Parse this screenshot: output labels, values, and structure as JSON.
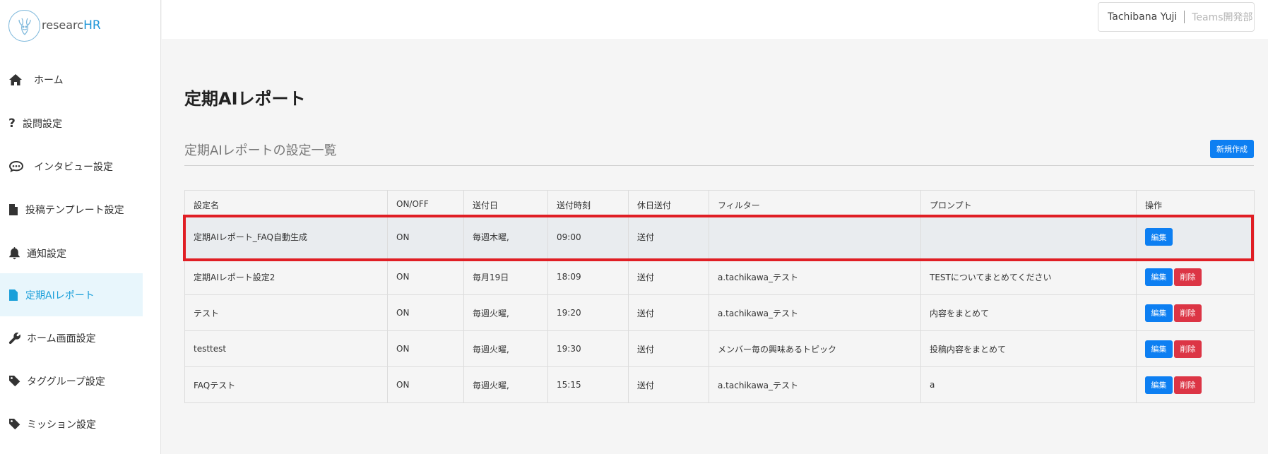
{
  "brand": {
    "text_main": "researc",
    "text_accent": "HR"
  },
  "sidebar": {
    "items": [
      {
        "label": "ホーム",
        "icon": "home-icon"
      },
      {
        "label": "設問設定",
        "icon": "question-icon"
      },
      {
        "label": "インタビュー設定",
        "icon": "chat-icon"
      },
      {
        "label": "投稿テンプレート設定",
        "icon": "file-icon"
      },
      {
        "label": "通知設定",
        "icon": "bell-icon"
      },
      {
        "label": "定期AIレポート",
        "icon": "file-text-icon",
        "active": true
      },
      {
        "label": "ホーム画面設定",
        "icon": "wrench-icon"
      },
      {
        "label": "タググループ設定",
        "icon": "tag-icon"
      },
      {
        "label": "ミッション設定",
        "icon": "tag-icon"
      }
    ]
  },
  "header": {
    "user_name": "Tachibana Yuji",
    "department": "Teams開発部"
  },
  "page": {
    "title": "定期AIレポート",
    "section_title": "定期AIレポートの設定一覧",
    "new_button": "新規作成"
  },
  "table": {
    "columns": [
      "設定名",
      "ON/OFF",
      "送付日",
      "送付時刻",
      "休日送付",
      "フィルター",
      "プロンプト",
      "操作"
    ],
    "rows": [
      {
        "name": "定期AIレポート_FAQ自動生成",
        "status": "ON",
        "day": "毎週木曜,",
        "time": "09:00",
        "holiday": "送付",
        "filter": "",
        "prompt": "",
        "edit": "編集",
        "delete": ""
      },
      {
        "name": "定期AIレポート設定2",
        "status": "ON",
        "day": "毎月19日",
        "time": "18:09",
        "holiday": "送付",
        "filter": "a.tachikawa_テスト",
        "prompt": "TESTについてまとめてください",
        "edit": "編集",
        "delete": "削除"
      },
      {
        "name": "テスト",
        "status": "ON",
        "day": "毎週火曜,",
        "time": "19:20",
        "holiday": "送付",
        "filter": "a.tachikawa_テスト",
        "prompt": "内容をまとめて",
        "edit": "編集",
        "delete": "削除"
      },
      {
        "name": "testtest",
        "status": "ON",
        "day": "毎週火曜,",
        "time": "19:30",
        "holiday": "送付",
        "filter": "メンバー毎の興味あるトピック",
        "prompt": "投稿内容をまとめて",
        "edit": "編集",
        "delete": "削除"
      },
      {
        "name": "FAQテスト",
        "status": "ON",
        "day": "毎週火曜,",
        "time": "15:15",
        "holiday": "送付",
        "filter": "a.tachikawa_テスト",
        "prompt": "a",
        "edit": "編集",
        "delete": "削除"
      }
    ]
  },
  "colors": {
    "accent": "#0d7ff2",
    "danger": "#dc3545",
    "highlight": "#e01e24",
    "active_nav": "#1a9fd9"
  }
}
